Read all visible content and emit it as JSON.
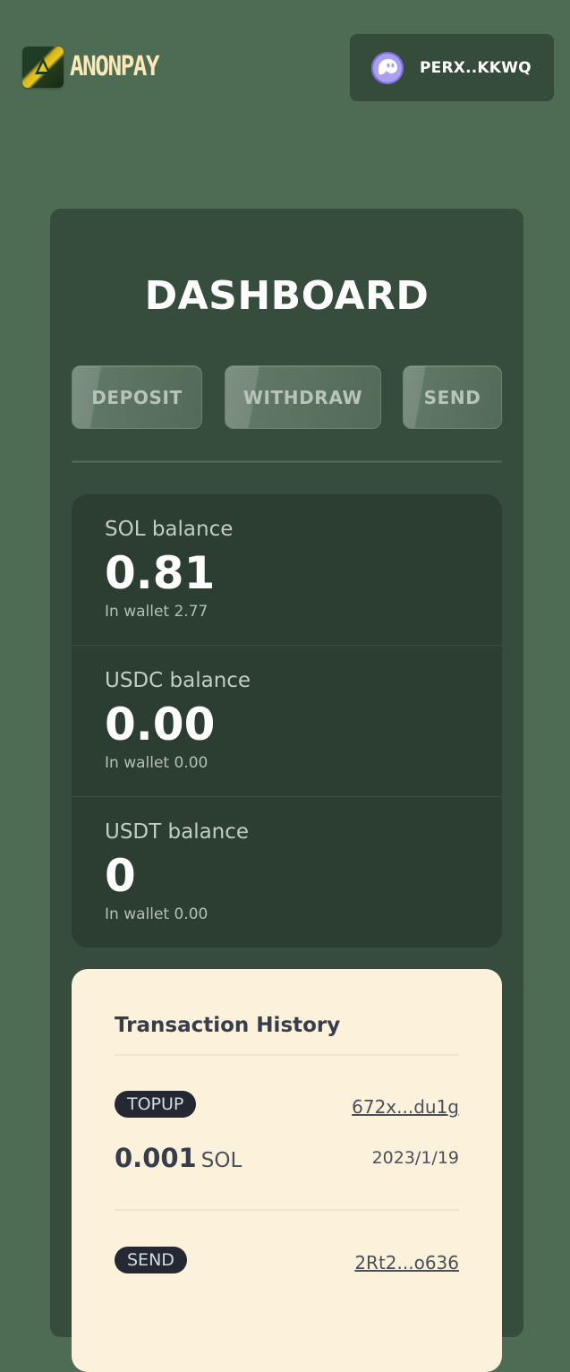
{
  "header": {
    "brand": "ANONPAY",
    "wallet_label": "PERX..KKWQ"
  },
  "dashboard": {
    "title": "DASHBOARD",
    "actions": [
      "DEPOSIT",
      "WITHDRAW",
      "SEND"
    ],
    "balances": [
      {
        "label": "SOL balance",
        "value": "0.81",
        "in_wallet": "In wallet 2.77"
      },
      {
        "label": "USDC balance",
        "value": "0.00",
        "in_wallet": "In wallet 0.00"
      },
      {
        "label": "USDT balance",
        "value": "0",
        "in_wallet": "In wallet 0.00"
      }
    ]
  },
  "history": {
    "title": "Transaction History",
    "transactions": [
      {
        "type": "TOPUP",
        "hash": "672x...du1g",
        "amount": "0.001",
        "unit": "SOL",
        "date": "2023/1/19"
      },
      {
        "type": "SEND",
        "hash": "2Rt2...o636"
      }
    ]
  }
}
